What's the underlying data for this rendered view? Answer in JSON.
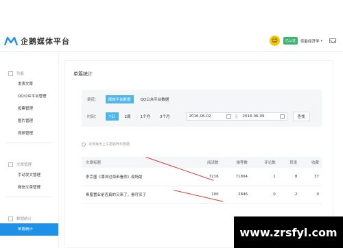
{
  "header": {
    "logo_text": "企鹅媒体平台",
    "badge": "已认证",
    "username": "佳能经济学",
    "caret": "▾"
  },
  "sidebar": {
    "groups": [
      {
        "heading": "功能",
        "items": [
          "发表文章",
          "QQ公众平台管理",
          "投票管理",
          "图片管理",
          "视频管理"
        ]
      },
      {
        "heading": "文章管理",
        "items": [
          "手动发文管理",
          "微信文章管理"
        ]
      },
      {
        "heading": "数据统计",
        "items": [
          "单篇统计"
        ]
      }
    ]
  },
  "main": {
    "title": "单篇统计",
    "channel_label": "渠道：",
    "channel_options": [
      "媒体平台数据",
      "QQ公众平台数据"
    ],
    "time_label": "时间：",
    "time_options": [
      "7日",
      "2周",
      "1个月",
      "3个月"
    ],
    "date_start": "2016-06-02",
    "date_sep": "至",
    "date_end": "2016-06-09",
    "query_label": "查找",
    "note": "本页每天上午更新昨日数据",
    "table": {
      "headers": [
        "文章标题",
        "阅读数",
        "推荐数",
        "评论数",
        "转发",
        "收藏"
      ],
      "rows": [
        [
          "李宗盛《漂洋过海来看你》现场版",
          "7216",
          "71804",
          "1",
          "8",
          "37"
        ],
        [
          "希腊置业是否真的又来了，看可实了",
          "100",
          "2846",
          "0",
          "2",
          "0"
        ]
      ]
    }
  },
  "watermark": "www.zrsfyl.com"
}
